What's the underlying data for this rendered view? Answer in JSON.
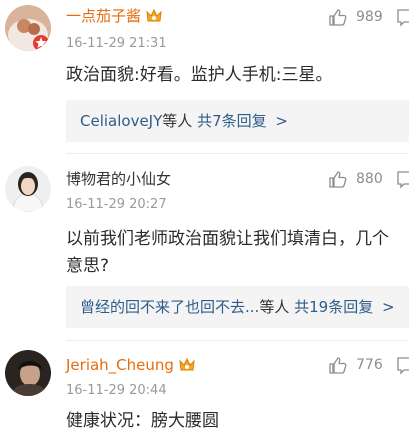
{
  "comments": [
    {
      "name": "一点茄子酱",
      "time": "16-11-29 21:31",
      "likes": "989",
      "text_lines": [
        "政治面貌:好看。监护人手机:三星。"
      ],
      "reply": {
        "users": "CelialoveJY",
        "suffix": "等人",
        "count": "共7条回复",
        "arrow": ">"
      }
    },
    {
      "name": "博物君的小仙女",
      "time": "16-11-29 20:27",
      "likes": "880",
      "text_lines": [
        "以前我们老师政治面貌让我们填清白，几个",
        "意思?"
      ],
      "reply": {
        "users": "曾经的回不来了也回不去...",
        "suffix": "等人",
        "count": "共19条回复",
        "arrow": ">"
      }
    },
    {
      "name": "Jeriah_Cheung",
      "time": "16-11-29 20:44",
      "likes": "776",
      "text_lines": [
        "健康状况：膀大腰圆"
      ]
    }
  ],
  "colors": {
    "orange_name": "#e86b0c",
    "link_blue": "#2d5d8a",
    "gray_text": "#9a9a9a",
    "reply_bg": "#f4f4f4"
  },
  "icons": [
    "thumbs-up-icon",
    "more-icon",
    "vip-badge-icon"
  ]
}
